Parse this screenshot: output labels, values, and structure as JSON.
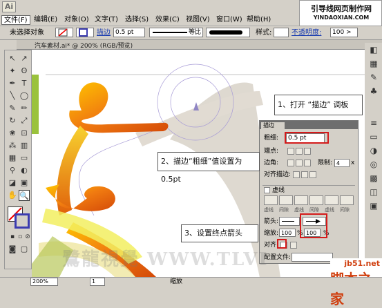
{
  "app": {
    "logo": "Ai",
    "doc_tab": "汽车素材.ai* @ 200% (RGB/预览)"
  },
  "banner": {
    "line1": "引导线网页制作网",
    "line2": "YINDAOXIAN.COM"
  },
  "menu": [
    "文件(F)",
    "编辑(E)",
    "对象(O)",
    "文字(T)",
    "选择(S)",
    "效果(C)",
    "视图(V)",
    "窗口(W)",
    "帮助(H)"
  ],
  "control": {
    "no_selection": "未选择对象",
    "stroke_label": "描边",
    "stroke_value": "0.5 pt",
    "profile": "等比",
    "style_label": "样式:",
    "opacity_label": "不透明度:",
    "opacity_value": "100 >"
  },
  "status": {
    "zoom": "200%",
    "page": "1",
    "mode": "缩放"
  },
  "panel": {
    "title": "描边",
    "weight_label": "粗细:",
    "weight_value": "0.5 pt",
    "cap_label": "端点:",
    "corner_label": "边角:",
    "limit_label": "限制:",
    "limit_value": "4",
    "limit_unit": "x",
    "align_label": "对齐描边:",
    "dashed_label": "虚线",
    "dash_fields": [
      "虚线",
      "间隙",
      "虚线",
      "间隙",
      "虚线",
      "间隙"
    ],
    "arrow_label": "箭头:",
    "scale_label": "缩放:",
    "scale_value_1": "100",
    "scale_value_2": "100",
    "percent": "%",
    "align2_label": "对齐:",
    "profile_label": "配置文件:"
  },
  "callouts": {
    "c1": "1、打开 “描边” 调板",
    "c2": "2、描边“粗细”值设置为 0.5pt",
    "c3": "3、设置终点箭头"
  },
  "watermarks": {
    "tlv": "鷺龍視覺 WWW.TLVI",
    "jb51": "jb51.net",
    "jiaoben": "脚本之家"
  }
}
